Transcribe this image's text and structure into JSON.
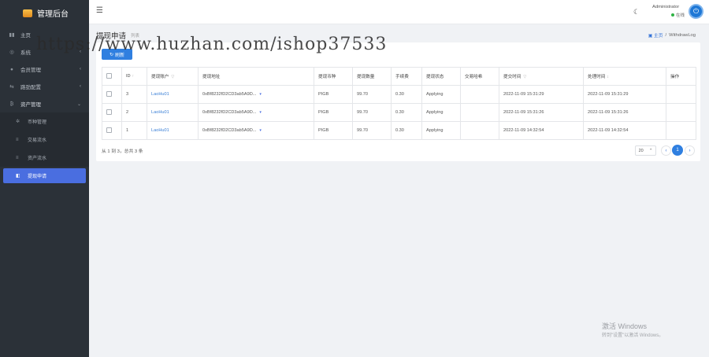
{
  "brand": {
    "title": "管理后台"
  },
  "sidebar": {
    "items": [
      {
        "label": "主页",
        "icon": "dashboard-icon"
      },
      {
        "label": "系统",
        "icon": "settings-icon",
        "has_children": true
      },
      {
        "label": "会员管理",
        "icon": "user-icon",
        "has_children": true
      },
      {
        "label": "路劲配置",
        "icon": "route-icon",
        "has_children": true
      },
      {
        "label": "资产管理",
        "icon": "asset-icon",
        "has_children": true,
        "open": true
      }
    ],
    "subitems": [
      {
        "label": "币种管理",
        "icon": "gear-icon"
      },
      {
        "label": "交易流水",
        "icon": "list-icon"
      },
      {
        "label": "资产流水",
        "icon": "list-icon"
      },
      {
        "label": "提现申请",
        "icon": "withdraw-icon",
        "active": true
      }
    ]
  },
  "topbar": {
    "menu_icon": "☰",
    "theme_icon": "☾",
    "admin_name": "Administrator",
    "admin_status": "在线",
    "power_icon": "⏻"
  },
  "page": {
    "title": "提现申请",
    "subtitle": "列表",
    "breadcrumb_home": "主页",
    "breadcrumb_sep": "/",
    "breadcrumb_current": "WithdrawLog"
  },
  "toolbar": {
    "refresh_label": "刷新",
    "refresh_icon": "↻"
  },
  "table": {
    "headers": [
      "",
      "ID",
      "提现账户",
      "提现地址",
      "提现币种",
      "提现数量",
      "手续费",
      "提现状态",
      "交易哈希",
      "提交时间",
      "处理时间",
      "操作"
    ],
    "rows": [
      {
        "id": "3",
        "account": "LaoHu01",
        "address": "0xBf8232fD2CD3ab5A9D...",
        "coin": "PIGB",
        "amount": "99.70",
        "fee": "0.30",
        "status": "Applying",
        "hash": "",
        "submitted": "2022-11-09 15:31:29",
        "processed": "2022-11-09 15:31:29",
        "action": ""
      },
      {
        "id": "2",
        "account": "LaoHu01",
        "address": "0xBf8232fD2CD3ab5A9D...",
        "coin": "PIGB",
        "amount": "99.70",
        "fee": "0.30",
        "status": "Applying",
        "hash": "",
        "submitted": "2022-11-09 15:31:26",
        "processed": "2022-11-09 15:31:26",
        "action": ""
      },
      {
        "id": "1",
        "account": "LaoHu01",
        "address": "0xBf8232fD2CD3ab5A9D...",
        "coin": "PIGB",
        "amount": "99.70",
        "fee": "0.30",
        "status": "Applying",
        "hash": "",
        "submitted": "2022-11-09 14:32:54",
        "processed": "2022-11-09 14:32:54",
        "action": ""
      }
    ]
  },
  "pagination": {
    "summary": "从 1 到 3，总共 3 条",
    "page_size": "20",
    "current_page": "1",
    "prev": "‹",
    "next": "›"
  },
  "watermark": {
    "url": "https://www.huzhan.com/ishop37533",
    "windows_line1": "激活 Windows",
    "windows_line2": "转到\"设置\"以激活 Windows。"
  }
}
